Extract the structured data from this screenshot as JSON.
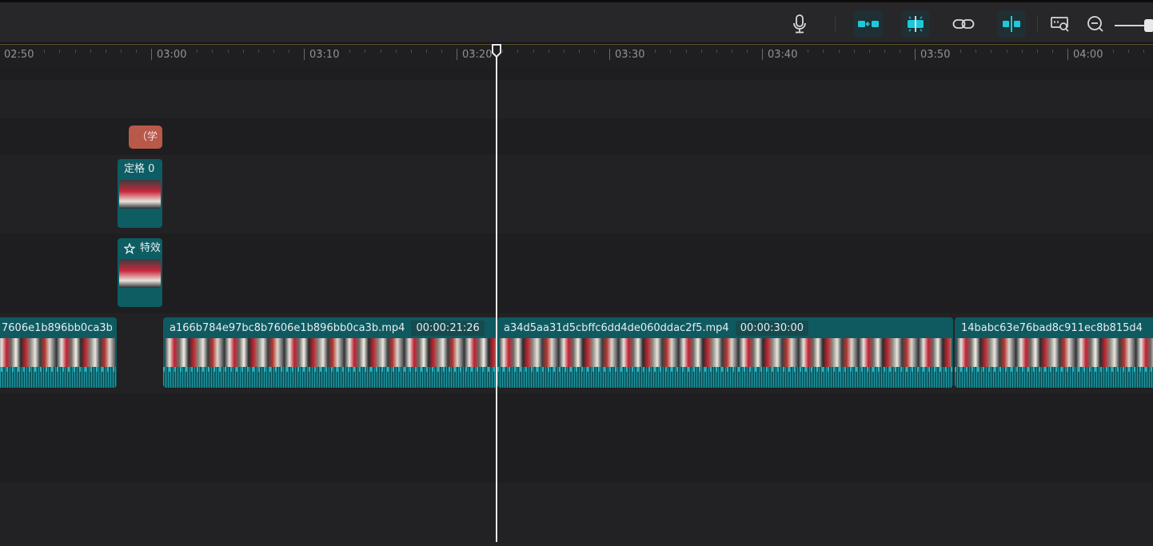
{
  "toolbar": {
    "buttons": [
      {
        "icon": "microphone-icon"
      },
      {
        "icon": "link-clips-icon",
        "active": true
      },
      {
        "icon": "snap-magnet-icon",
        "active": true
      },
      {
        "icon": "chain-link-icon"
      },
      {
        "icon": "split-preview-icon",
        "active": true
      },
      {
        "icon": "preview-zoom-icon"
      },
      {
        "icon": "zoom-out-icon"
      }
    ],
    "accent": "#1ec8d8"
  },
  "ruler": {
    "labels": [
      "02:50",
      "03:00",
      "03:10",
      "03:20",
      "03:30",
      "03:40",
      "03:50",
      "04:00"
    ]
  },
  "tracks": {
    "text_chip": {
      "label": "（学"
    },
    "freeze_clip": {
      "label": "定格 0"
    },
    "effect_clip": {
      "label": "特效"
    },
    "main_clips": [
      {
        "name": "7606e1b896bb0ca3b",
        "duration": ""
      },
      {
        "name": "a166b784e97bc8b7606e1b896bb0ca3b.mp4",
        "duration": "00:00:21:26"
      },
      {
        "name": "a34d5aa31d5cbffc6dd4de060ddac2f5.mp4",
        "duration": "00:00:30:00"
      },
      {
        "name": "14babc63e76bad8c911ec8b815d4",
        "duration": ""
      }
    ]
  },
  "colors": {
    "clip": "#0f5a61",
    "title_chip": "#b8594a",
    "playhead": "#e9e9e9"
  }
}
